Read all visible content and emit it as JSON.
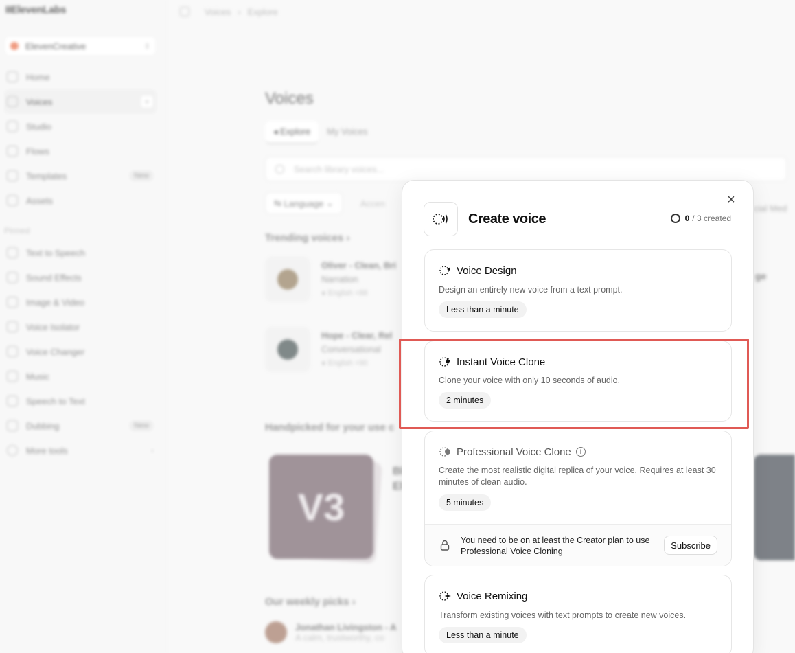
{
  "background": {
    "logo": "IIElevenLabs",
    "workspace": "ElevenCreative",
    "nav": [
      {
        "label": "Home"
      },
      {
        "label": "Voices",
        "active": true
      },
      {
        "label": "Studio"
      },
      {
        "label": "Flows"
      },
      {
        "label": "Templates",
        "badge": "New"
      },
      {
        "label": "Assets"
      }
    ],
    "pinned_label": "Pinned",
    "pinned": [
      {
        "label": "Text to Speech"
      },
      {
        "label": "Sound Effects"
      },
      {
        "label": "Image & Video"
      },
      {
        "label": "Voice Isolator"
      },
      {
        "label": "Voice Changer"
      },
      {
        "label": "Music"
      },
      {
        "label": "Speech to Text"
      },
      {
        "label": "Dubbing",
        "badge": "New"
      },
      {
        "label": "More tools"
      }
    ],
    "breadcrumb": [
      "Voices",
      "Explore"
    ],
    "page_title": "Voices",
    "tabs": [
      "Explore",
      "My Voices"
    ],
    "search_placeholder": "Search library voices...",
    "filter_language": "Language",
    "filter_accent": "Accen",
    "filter_right": "cial Med",
    "trending_title": "Trending voices",
    "trending": [
      {
        "name": "Oliver - Clean, Bri",
        "category": "Narration",
        "lang": "English",
        "tag": "+88"
      },
      {
        "name": "Hope - Clear, Rel",
        "category": "Conversational",
        "lang": "English",
        "tag": "+90"
      }
    ],
    "right_trunc": "ge",
    "handpicked_title": "Handpicked for your use c",
    "v3_label": "V3",
    "v3_side": "Bl\nEl",
    "weekly_title": "Our weekly picks",
    "weekly_name": "Jonathan Livingston - A",
    "weekly_desc": "A calm, trustworthy, co"
  },
  "modal": {
    "title": "Create voice",
    "count_current": "0",
    "count_rest": "/ 3 created",
    "options": [
      {
        "title": "Voice Design",
        "desc": "Design an entirely new voice from a text prompt.",
        "pill": "Less than a minute"
      },
      {
        "title": "Instant Voice Clone",
        "desc": "Clone your voice with only 10 seconds of audio.",
        "pill": "2 minutes"
      },
      {
        "title": "Professional Voice Clone",
        "desc": "Create the most realistic digital replica of your voice. Requires at least 30 minutes of clean audio.",
        "pill": "5 minutes",
        "lock_text": "You need to be on at least the Creator plan to use Professional Voice Cloning",
        "subscribe": "Subscribe"
      },
      {
        "title": "Voice Remixing",
        "desc": "Transform existing voices with text prompts to create new voices.",
        "pill": "Less than a minute"
      }
    ]
  }
}
